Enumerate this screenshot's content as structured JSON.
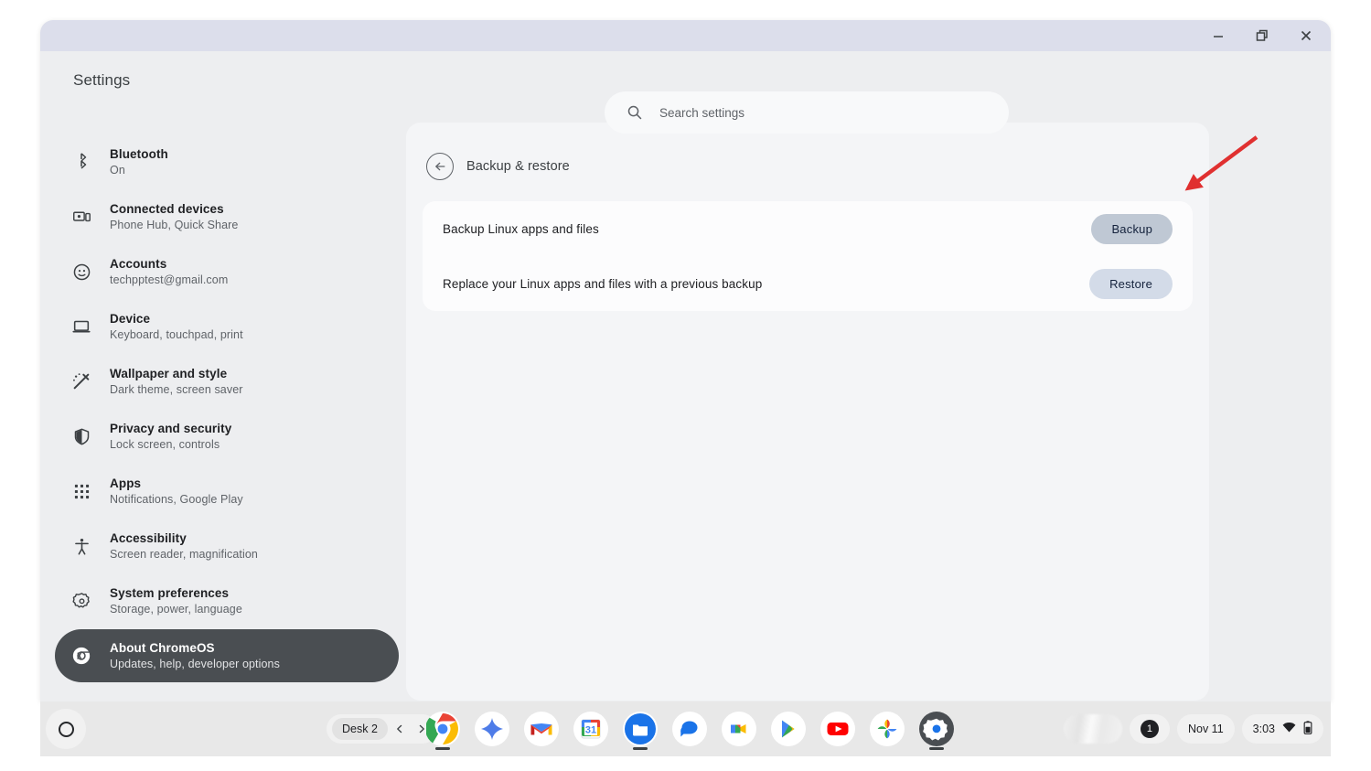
{
  "window": {
    "controls": [
      {
        "name": "minimize",
        "label": "Minimize"
      },
      {
        "name": "restore",
        "label": "Restore"
      },
      {
        "name": "close",
        "label": "Close"
      }
    ],
    "titlebar_color": "#dcdeeb"
  },
  "header": {
    "title": "Settings"
  },
  "search": {
    "placeholder": "Search settings",
    "value": "",
    "icon": "search-icon"
  },
  "sidebar": {
    "items": [
      {
        "icon": "bluetooth-icon",
        "label": "Bluetooth",
        "sublabel": "On",
        "selected": false
      },
      {
        "icon": "connected-devices-icon",
        "label": "Connected devices",
        "sublabel": "Phone Hub, Quick Share",
        "selected": false
      },
      {
        "icon": "accounts-icon",
        "label": "Accounts",
        "sublabel": "techpptest@gmail.com",
        "selected": false
      },
      {
        "icon": "device-icon",
        "label": "Device",
        "sublabel": "Keyboard, touchpad, print",
        "selected": false
      },
      {
        "icon": "wallpaper-style-icon",
        "label": "Wallpaper and style",
        "sublabel": "Dark theme, screen saver",
        "selected": false
      },
      {
        "icon": "shield-icon",
        "label": "Privacy and security",
        "sublabel": "Lock screen, controls",
        "selected": false
      },
      {
        "icon": "apps-grid-icon",
        "label": "Apps",
        "sublabel": "Notifications, Google Play",
        "selected": false
      },
      {
        "icon": "accessibility-icon",
        "label": "Accessibility",
        "sublabel": "Screen reader, magnification",
        "selected": false
      },
      {
        "icon": "gear-icon",
        "label": "System preferences",
        "sublabel": "Storage, power, language",
        "selected": false
      },
      {
        "icon": "chrome-icon",
        "label": "About ChromeOS",
        "sublabel": "Updates, help, developer options",
        "selected": true
      }
    ]
  },
  "main": {
    "back_icon": "back-arrow-icon",
    "panel_title": "Backup & restore",
    "rows": [
      {
        "label": "Backup Linux apps and files",
        "button": "Backup",
        "state": "hovered"
      },
      {
        "label": "Replace your Linux apps and files with a previous backup",
        "button": "Restore",
        "state": "normal"
      }
    ],
    "annotation": {
      "type": "arrow",
      "color": "#e03030",
      "points_to": "Backup"
    }
  },
  "shelf": {
    "launcher": {
      "icon": "launcher-circle-icon"
    },
    "desk": {
      "label": "Desk 2",
      "prev_icon": "chevron-left-icon",
      "next_icon": "chevron-right-icon"
    },
    "apps": [
      {
        "name": "chrome",
        "icon": "chrome-icon",
        "active": true
      },
      {
        "name": "gemini",
        "icon": "gemini-icon",
        "active": false
      },
      {
        "name": "gmail",
        "icon": "gmail-icon",
        "active": false
      },
      {
        "name": "calendar",
        "icon": "calendar-icon",
        "active": false,
        "day": "31"
      },
      {
        "name": "files",
        "icon": "files-icon",
        "active": true
      },
      {
        "name": "messages",
        "icon": "messages-icon",
        "active": false
      },
      {
        "name": "meet",
        "icon": "meet-icon",
        "active": false
      },
      {
        "name": "play-store",
        "icon": "play-store-icon",
        "active": false
      },
      {
        "name": "youtube",
        "icon": "youtube-icon",
        "active": false
      },
      {
        "name": "photos",
        "icon": "photos-icon",
        "active": false
      },
      {
        "name": "settings",
        "icon": "settings-gear-icon",
        "active": true
      }
    ],
    "status": {
      "notification_count": "1",
      "date": "Nov 11",
      "time": "3:03",
      "wifi_icon": "wifi-icon",
      "battery_icon": "battery-icon"
    }
  }
}
